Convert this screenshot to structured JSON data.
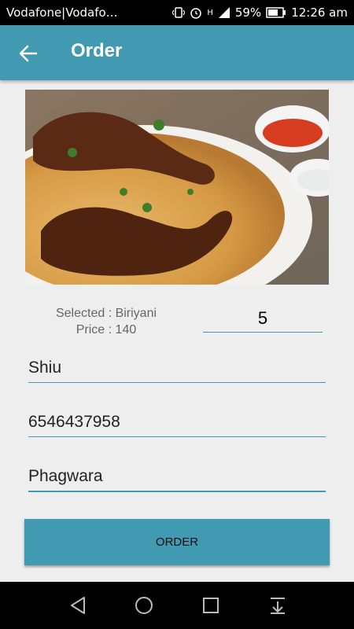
{
  "status_bar": {
    "carrier": "Vodafone|Vodafo…",
    "signal_text": "H",
    "battery_percent": "59%",
    "time": "12:26 am",
    "icons": [
      "vibrate-icon",
      "alarm-icon",
      "signal-icon",
      "battery-icon"
    ]
  },
  "app_bar": {
    "title": "Order",
    "back_icon": "arrow-left-icon"
  },
  "food": {
    "image_alt": "food image"
  },
  "selection": {
    "selected_text": "Selected : Biriyani",
    "price_text": "Price : 140"
  },
  "form": {
    "quantity": "5",
    "name": "Shiu",
    "phone": "6546437958",
    "address": "Phagwara"
  },
  "order_button": {
    "label": "ORDER"
  },
  "nav_bar": {
    "icons": [
      "back-triangle-icon",
      "home-circle-icon",
      "recents-square-icon",
      "notification-pull-icon"
    ]
  },
  "colors": {
    "accent": "#4299b2",
    "background": "#eeeeee"
  }
}
